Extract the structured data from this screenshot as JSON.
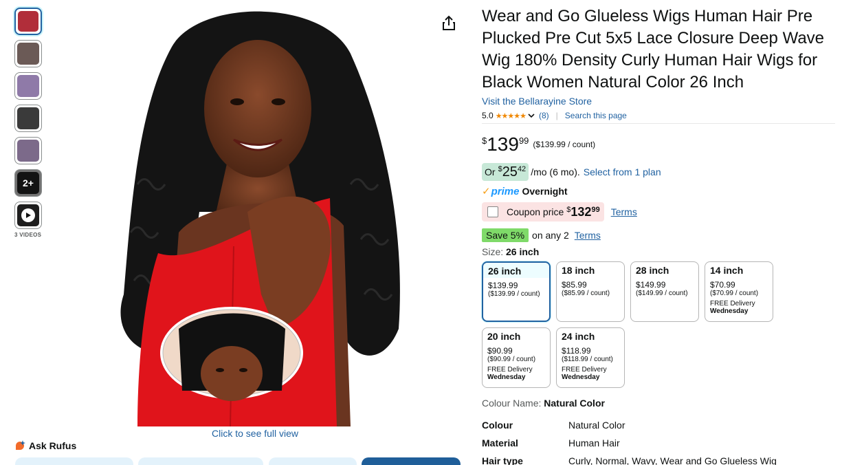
{
  "gallery": {
    "thumbnails": [
      {
        "kind": "image",
        "color": "#b12e3a"
      },
      {
        "kind": "image",
        "color": "#6b5a56"
      },
      {
        "kind": "image",
        "color": "#8f7aa8"
      },
      {
        "kind": "image",
        "color": "#3a3a3a"
      },
      {
        "kind": "image",
        "color": "#7c6a8a"
      },
      {
        "kind": "more",
        "label": "2+",
        "color": "#2b2b2b"
      },
      {
        "kind": "video",
        "color": "#1e1e1e"
      }
    ],
    "videos_label": "3 VIDEOS",
    "full_view_link": "Click to see full view",
    "ask_rufus": "Ask Rufus"
  },
  "product": {
    "title": "Wear and Go Glueless Wigs Human Hair Pre Plucked Pre Cut 5x5 Lace Closure Deep Wave Wig 180% Density Curly Human Hair Wigs for Black Women Natural Color 26 Inch",
    "store_link": "Visit the Bellarayine Store",
    "rating_value": "5.0",
    "stars": "★★★★★",
    "rating_count": "(8)",
    "search_page": "Search this page"
  },
  "price": {
    "currency": "$",
    "whole": "139",
    "fraction": "99",
    "unit_price": "($139.99 / count)"
  },
  "monthly": {
    "prefix": "Or",
    "currency": "$",
    "whole": "25",
    "fraction": "42",
    "suffix": "/mo (6 mo).",
    "link": "Select from 1 plan"
  },
  "prime": {
    "check": "✓",
    "word": "prime",
    "label": "Overnight"
  },
  "coupon": {
    "label": "Coupon price",
    "currency": "$",
    "whole": "132",
    "fraction": "99",
    "terms": "Terms"
  },
  "save": {
    "badge": "Save 5%",
    "text": "on any 2",
    "terms": "Terms"
  },
  "size": {
    "label": "Size:",
    "selected": "26 inch",
    "options": [
      {
        "name": "26 inch",
        "price": "$139.99",
        "unit": "($139.99 / count)",
        "delivery": "",
        "day": "",
        "selected": true
      },
      {
        "name": "18 inch",
        "price": "$85.99",
        "unit": "($85.99 / count)",
        "delivery": "",
        "day": "",
        "selected": false
      },
      {
        "name": "28 inch",
        "price": "$149.99",
        "unit": "($149.99 / count)",
        "delivery": "",
        "day": "",
        "selected": false
      },
      {
        "name": "14 inch",
        "price": "$70.99",
        "unit": "($70.99 / count)",
        "delivery": "FREE Delivery",
        "day": "Wednesday",
        "selected": false
      },
      {
        "name": "20 inch",
        "price": "$90.99",
        "unit": "($90.99 / count)",
        "delivery": "FREE Delivery",
        "day": "Wednesday",
        "selected": false
      },
      {
        "name": "24 inch",
        "price": "$118.99",
        "unit": "($118.99 / count)",
        "delivery": "FREE Delivery",
        "day": "Wednesday",
        "selected": false
      }
    ]
  },
  "colour": {
    "label": "Colour Name:",
    "value": "Natural Color"
  },
  "specs": [
    {
      "key": "Colour",
      "value": "Natural Color"
    },
    {
      "key": "Material",
      "value": "Human Hair"
    },
    {
      "key": "Hair type",
      "value": "Curly, Normal, Wavy, Wear and Go Glueless Wig"
    }
  ]
}
